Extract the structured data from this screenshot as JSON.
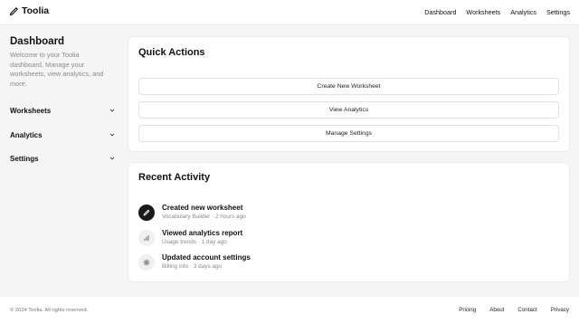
{
  "brand": {
    "name": "Toolia",
    "icon": "pencil-icon"
  },
  "nav": {
    "links": [
      "Dashboard",
      "Worksheets",
      "Analytics",
      "Settings"
    ]
  },
  "sidebar": {
    "title": "Dashboard",
    "description": "Welcome to your Toolia dashboard. Manage your worksheets, view analytics, and more.",
    "sections": [
      {
        "label": "Worksheets",
        "icon": "chevron-down-icon"
      },
      {
        "label": "Analytics",
        "icon": "chevron-down-icon"
      },
      {
        "label": "Settings",
        "icon": "chevron-down-icon"
      }
    ]
  },
  "quick_actions": {
    "title": "Quick Actions",
    "buttons": [
      "Create New Worksheet",
      "View Analytics",
      "Manage Settings"
    ]
  },
  "recent_activity": {
    "title": "Recent Activity",
    "items": [
      {
        "title": "Created new worksheet",
        "detail": "Vocabulary Builder · 2 hours ago",
        "icon": "pencil-icon"
      },
      {
        "title": "Viewed analytics report",
        "detail": "Usage trends · 1 day ago",
        "icon": "bar-chart-icon"
      },
      {
        "title": "Updated account settings",
        "detail": "Billing info · 3 days ago",
        "icon": "gear-icon"
      }
    ]
  },
  "footer": {
    "copyright": "© 2024 Toolia. All rights reserved.",
    "links": [
      "Pricing",
      "About",
      "Contact",
      "Privacy"
    ]
  }
}
